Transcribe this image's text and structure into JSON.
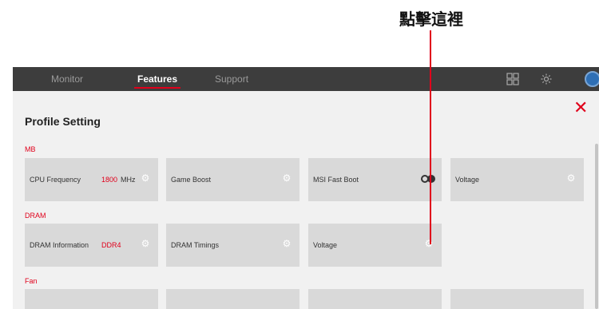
{
  "callout": {
    "text": "點擊這裡"
  },
  "nav": {
    "tabs": [
      {
        "label": "Monitor"
      },
      {
        "label": "Features"
      },
      {
        "label": "Support"
      }
    ]
  },
  "panel": {
    "title": "Profile Setting",
    "close_icon": "close-icon"
  },
  "sections": {
    "mb": {
      "label": "MB",
      "cards": [
        {
          "label": "CPU Frequency",
          "value": "1800",
          "unit": "MHz"
        },
        {
          "label": "Game Boost"
        },
        {
          "label": "MSI Fast Boot",
          "toggle": "on"
        },
        {
          "label": "Voltage"
        }
      ]
    },
    "dram": {
      "label": "DRAM",
      "cards": [
        {
          "label": "DRAM Information",
          "value": "DDR4"
        },
        {
          "label": "DRAM Timings"
        },
        {
          "label": "Voltage"
        }
      ]
    },
    "fan": {
      "label": "Fan"
    }
  },
  "colors": {
    "accent": "#e0001b",
    "topbar": "#3d3d3d",
    "card": "#d9d9d9",
    "panel": "#f1f1f1"
  },
  "icons": {
    "grid": "grid-icon",
    "settings": "gear-icon",
    "avatar": "avatar-icon",
    "card_settings": "gear-icon"
  }
}
